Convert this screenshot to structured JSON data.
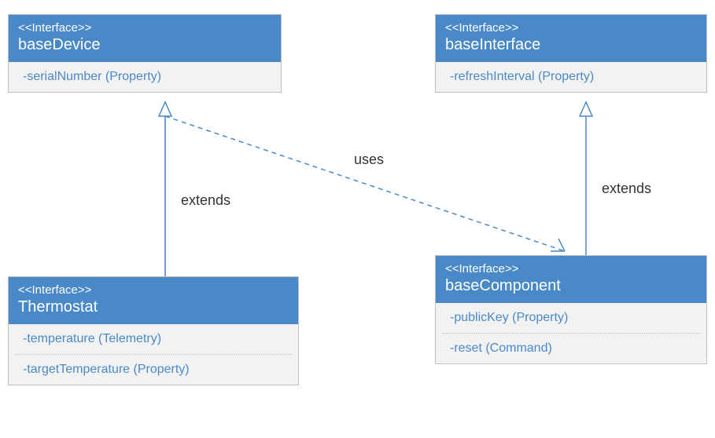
{
  "boxes": {
    "baseDevice": {
      "stereotype": "<<Interface>>",
      "name": "baseDevice",
      "members": [
        "-serialNumber (Property)"
      ]
    },
    "baseInterface": {
      "stereotype": "<<Interface>>",
      "name": "baseInterface",
      "members": [
        "-refreshInterval (Property)"
      ]
    },
    "thermostat": {
      "stereotype": "<<Interface>>",
      "name": "Thermostat",
      "members": [
        "-temperature (Telemetry)",
        "-targetTemperature (Property)"
      ]
    },
    "baseComponent": {
      "stereotype": "<<Interface>>",
      "name": "baseComponent",
      "members": [
        "-publicKey (Property)",
        "-reset (Command)"
      ]
    }
  },
  "labels": {
    "extends_left": "extends",
    "extends_right": "extends",
    "uses": "uses"
  },
  "chart_data": {
    "type": "diagram",
    "description": "UML-style interface inheritance diagram",
    "interfaces": [
      {
        "name": "baseDevice",
        "stereotype": "Interface",
        "members": [
          {
            "name": "serialNumber",
            "kind": "Property",
            "visibility": "-"
          }
        ]
      },
      {
        "name": "baseInterface",
        "stereotype": "Interface",
        "members": [
          {
            "name": "refreshInterval",
            "kind": "Property",
            "visibility": "-"
          }
        ]
      },
      {
        "name": "Thermostat",
        "stereotype": "Interface",
        "members": [
          {
            "name": "temperature",
            "kind": "Telemetry",
            "visibility": "-"
          },
          {
            "name": "targetTemperature",
            "kind": "Property",
            "visibility": "-"
          }
        ]
      },
      {
        "name": "baseComponent",
        "stereotype": "Interface",
        "members": [
          {
            "name": "publicKey",
            "kind": "Property",
            "visibility": "-"
          },
          {
            "name": "reset",
            "kind": "Command",
            "visibility": "-"
          }
        ]
      }
    ],
    "relationships": [
      {
        "from": "Thermostat",
        "to": "baseDevice",
        "type": "extends"
      },
      {
        "from": "baseComponent",
        "to": "baseInterface",
        "type": "extends"
      },
      {
        "from": "Thermostat",
        "to": "baseComponent",
        "type": "uses"
      }
    ]
  }
}
